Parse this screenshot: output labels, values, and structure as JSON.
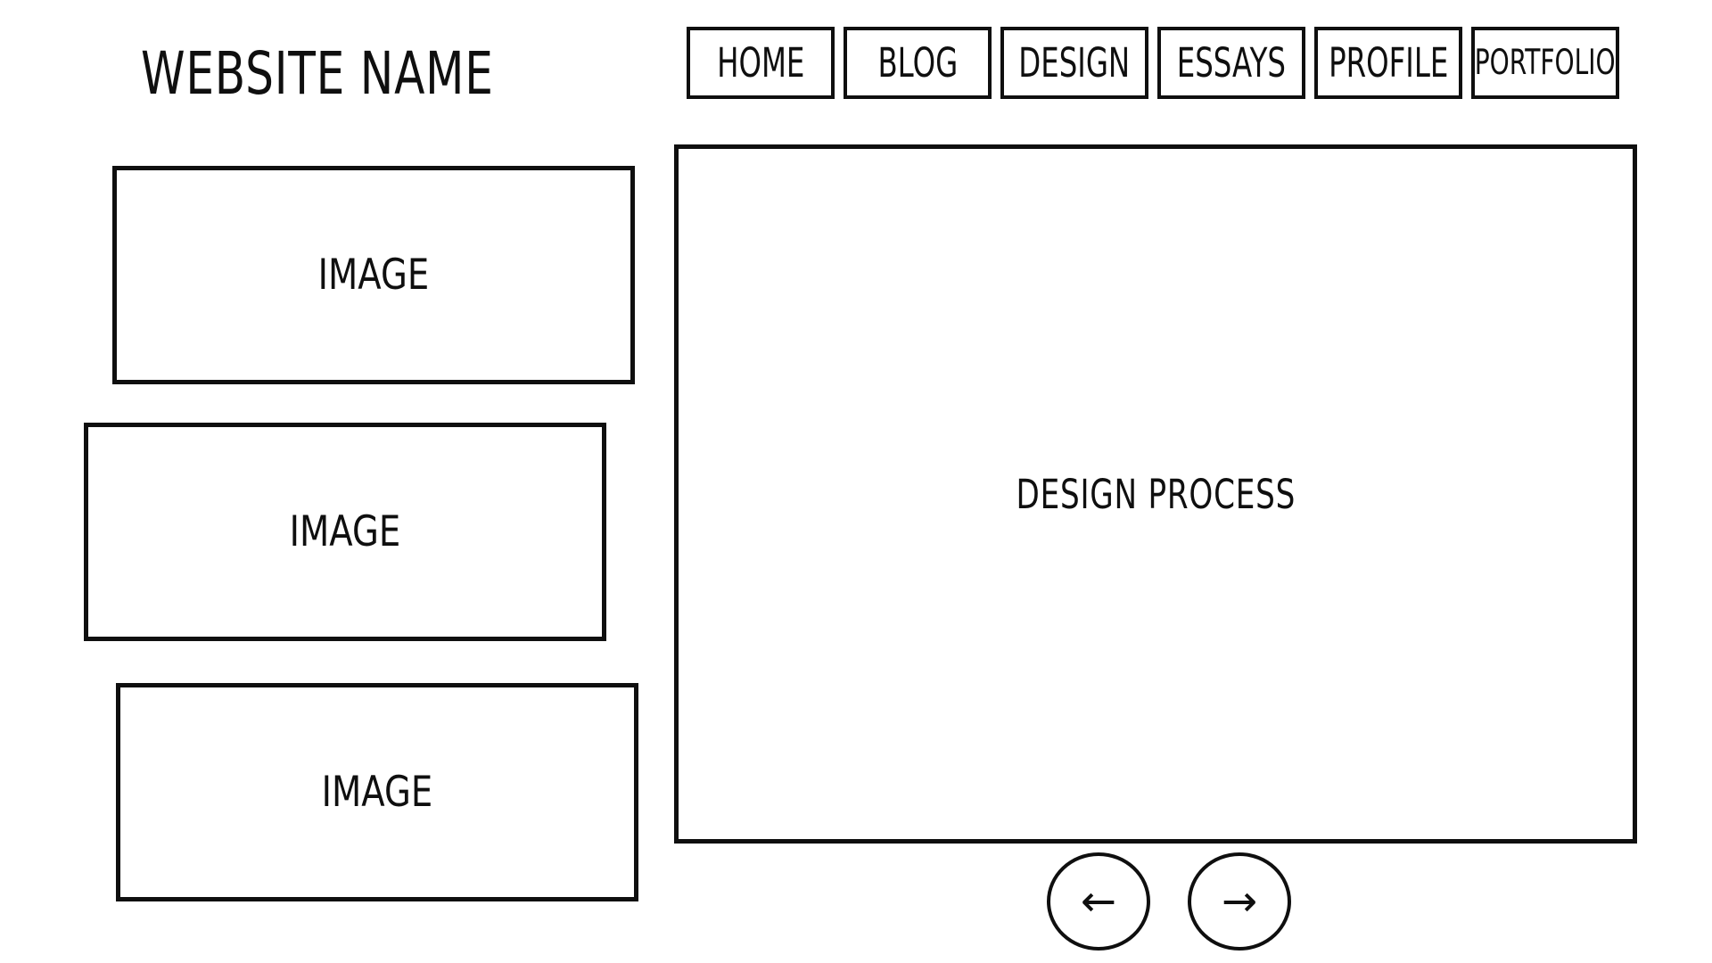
{
  "header": {
    "site_name": "WEBSITE NAME"
  },
  "nav": {
    "items": [
      {
        "label": "HOME"
      },
      {
        "label": "BLOG"
      },
      {
        "label": "DESIGN"
      },
      {
        "label": "ESSAYS"
      },
      {
        "label": "PROFILE"
      },
      {
        "label": "PORTFOLIO"
      }
    ]
  },
  "sidebar": {
    "images": [
      {
        "label": "IMAGE"
      },
      {
        "label": "IMAGE"
      },
      {
        "label": "IMAGE"
      }
    ]
  },
  "main": {
    "panel_label": "DESIGN PROCESS"
  },
  "pager": {
    "prev_icon": "left-arrow-icon",
    "next_icon": "right-arrow-icon",
    "prev_glyph": "←",
    "next_glyph": "→"
  }
}
